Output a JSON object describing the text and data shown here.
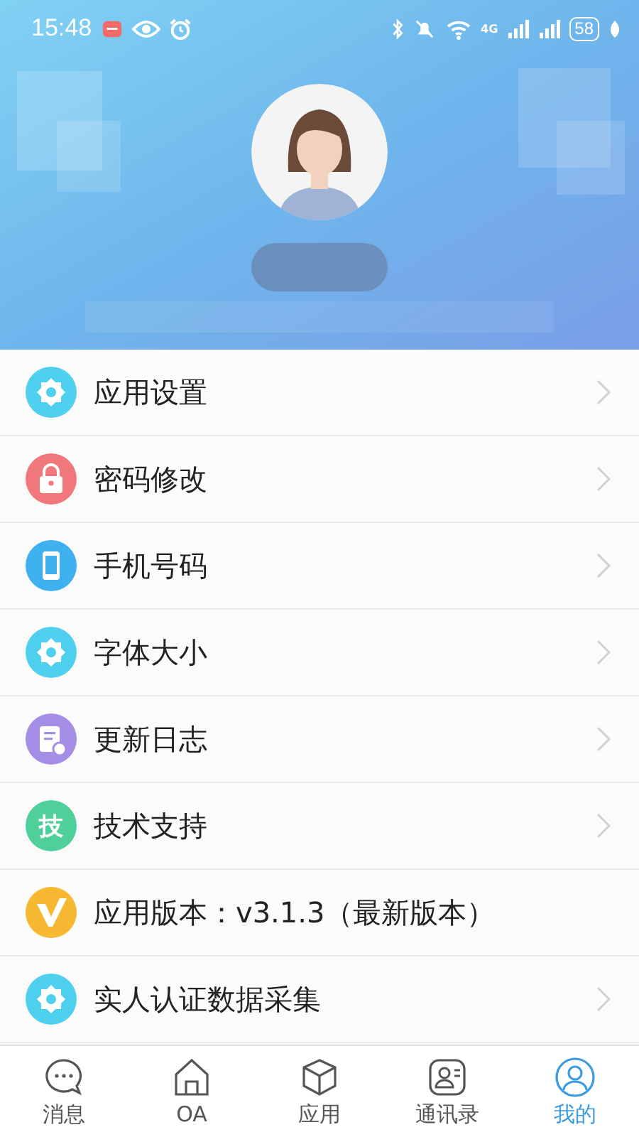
{
  "status_bar": {
    "time": "15:48",
    "battery": "58",
    "network": "4G"
  },
  "menu": [
    {
      "kind": "gear",
      "color": "#4fd0ee",
      "label": "应用设置",
      "chevron": true
    },
    {
      "kind": "lock",
      "color": "#f0787c",
      "label": "密码修改",
      "chevron": true
    },
    {
      "kind": "phone",
      "color": "#3fb0f0",
      "label": "手机号码",
      "chevron": true
    },
    {
      "kind": "gear",
      "color": "#4fd0ee",
      "label": "字体大小",
      "chevron": true
    },
    {
      "kind": "log",
      "color": "#a48ee6",
      "label": "更新日志",
      "chevron": true
    },
    {
      "kind": "text",
      "badge": "技",
      "color": "#4fcf9a",
      "label": "技术支持",
      "chevron": true
    },
    {
      "kind": "v",
      "color": "#f5b830",
      "label": "应用版本：v3.1.3（最新版本）",
      "chevron": false
    },
    {
      "kind": "gear",
      "color": "#4fd0ee",
      "label": "实人认证数据采集",
      "chevron": true
    }
  ],
  "tabs": [
    {
      "kind": "chat",
      "label": "消息",
      "selected": false
    },
    {
      "kind": "home",
      "label": "OA",
      "selected": false
    },
    {
      "kind": "cube",
      "label": "应用",
      "selected": false
    },
    {
      "kind": "contacts",
      "label": "通讯录",
      "selected": false
    },
    {
      "kind": "person",
      "label": "我的",
      "selected": true
    }
  ]
}
